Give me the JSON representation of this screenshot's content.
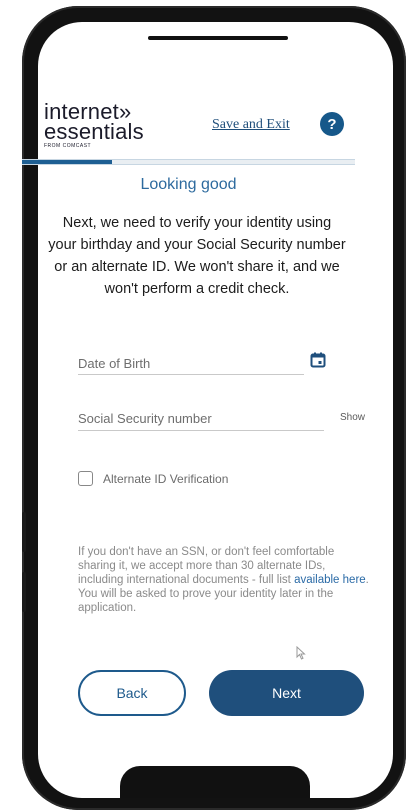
{
  "header": {
    "logo": {
      "line1": "internet»",
      "line2": "essentials",
      "sub": "FROM COMCAST"
    },
    "save_exit_label": "Save and Exit",
    "help_label": "?"
  },
  "progress": {
    "value": 0.27
  },
  "page": {
    "title": "Looking good",
    "intro": "Next, we need to verify your identity using your birthday and your Social Security number or an alternate ID. We won't share it, and we won't perform a credit check."
  },
  "form": {
    "dob": {
      "placeholder": "Date of Birth"
    },
    "ssn": {
      "placeholder": "Social Security number",
      "show_label": "Show"
    },
    "alternate_id": {
      "label": "Alternate ID Verification",
      "checked": false
    }
  },
  "note": {
    "text_before": "If you don't have an SSN, or don't feel comfortable sharing it, we accept more than 30 alternate IDs, including international documents - full list ",
    "link": "available here",
    "text_after": ". You will be asked to prove your identity later in the application."
  },
  "actions": {
    "back_label": "Back",
    "next_label": "Next"
  },
  "colors": {
    "primary": "#1f4f7c",
    "accent": "#2d6a9e",
    "help": "#16588a"
  }
}
